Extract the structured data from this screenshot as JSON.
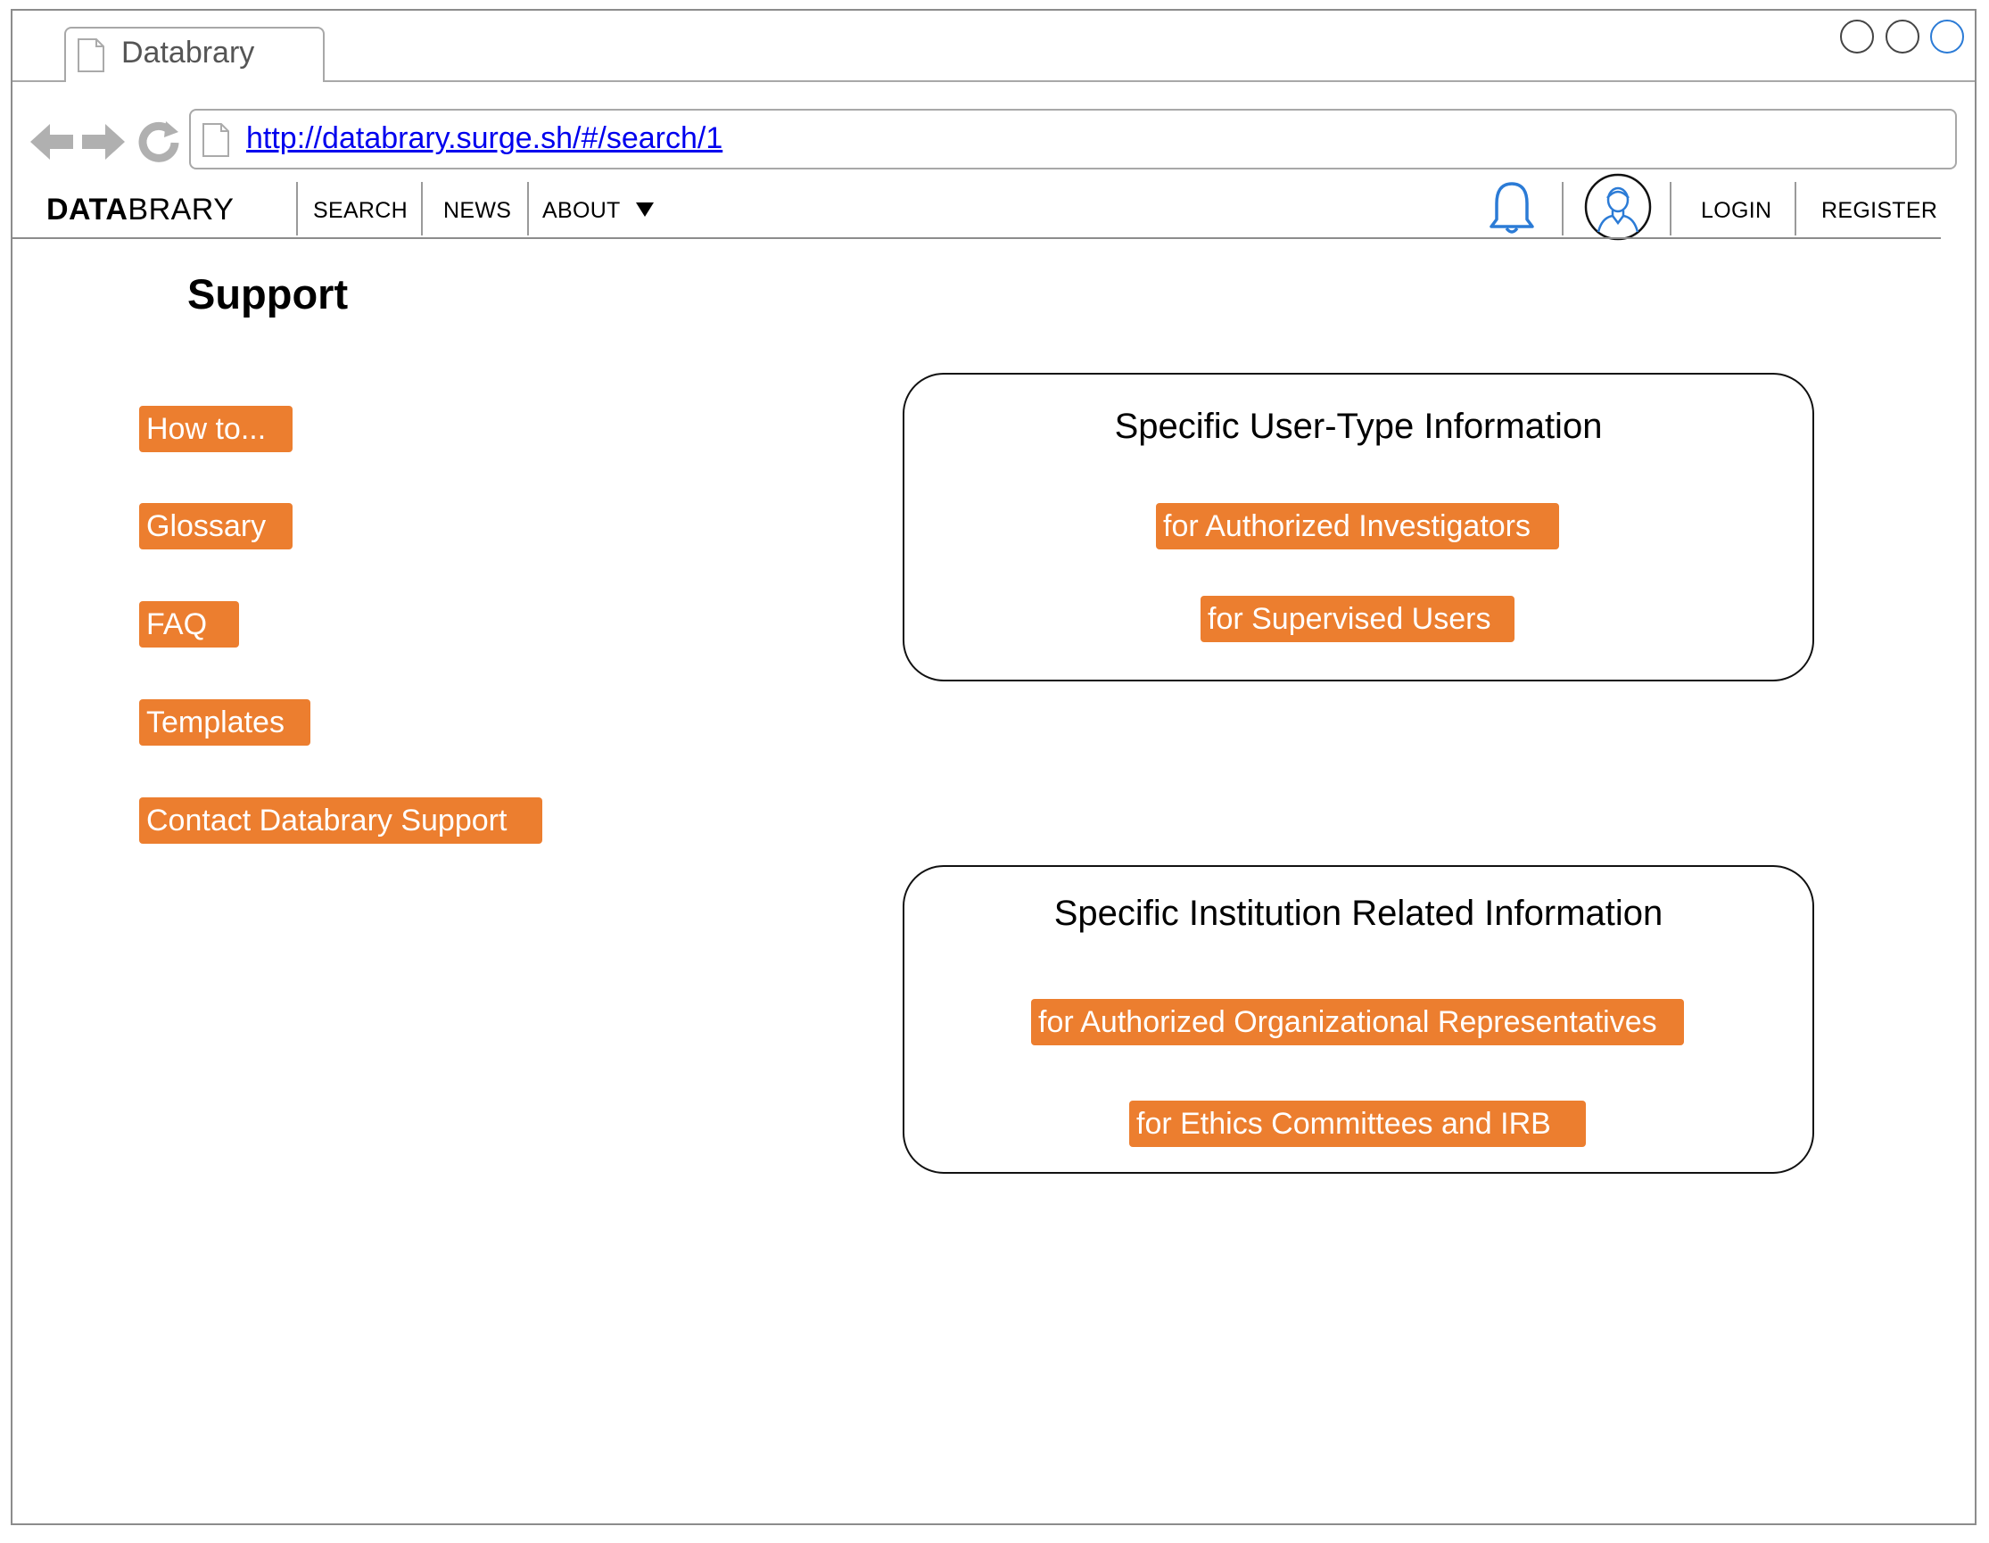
{
  "browser": {
    "tab_title": "Databrary",
    "url": "http://databrary.surge.sh/#/search/1"
  },
  "nav": {
    "brand_bold": "DATA",
    "brand_light": "BRARY",
    "search": "SEARCH",
    "news": "NEWS",
    "about": "ABOUT",
    "login": "LOGIN",
    "register": "REGISTER"
  },
  "page": {
    "title": "Support",
    "links": {
      "how_to": "How to...",
      "glossary": "Glossary",
      "faq": "FAQ",
      "templates": "Templates",
      "contact": "Contact Databrary Support"
    }
  },
  "user_panel": {
    "title": "Specific User-Type Information",
    "investigators": "for Authorized Investigators",
    "supervised": "for Supervised Users"
  },
  "institution_panel": {
    "title": "Specific Institution Related Information",
    "org_reps": "for Authorized Organizational Representatives",
    "ethics": "for Ethics Committees and IRB"
  },
  "colors": {
    "accent": "#ec7e2f",
    "icon_blue": "#2b7bd6",
    "link": "#0000ee"
  }
}
